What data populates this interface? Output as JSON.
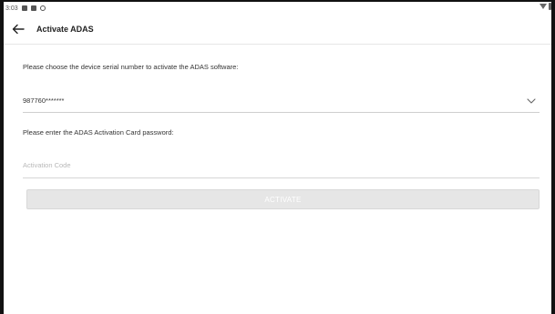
{
  "status_bar": {
    "time": "3:03",
    "icons": [
      "image-icon",
      "app-icon",
      "settings-icon",
      "wifi-icon",
      "battery-icon"
    ]
  },
  "app_bar": {
    "back_icon": "arrow-left-icon",
    "title": "Activate ADAS"
  },
  "form": {
    "serial_prompt": "Please choose the device serial number to activate the ADAS software:",
    "serial_value": "987760*******",
    "dropdown_icon": "chevron-down-icon",
    "password_prompt": "Please enter the ADAS Activation Card password:",
    "code_placeholder": "Activation Code",
    "code_value": ""
  },
  "actions": {
    "activate_label": "ACTIVATE"
  },
  "colors": {
    "button_disabled_bg": "#e6e6e6",
    "divider": "#cfcfcf",
    "placeholder": "#b8b8b8"
  }
}
